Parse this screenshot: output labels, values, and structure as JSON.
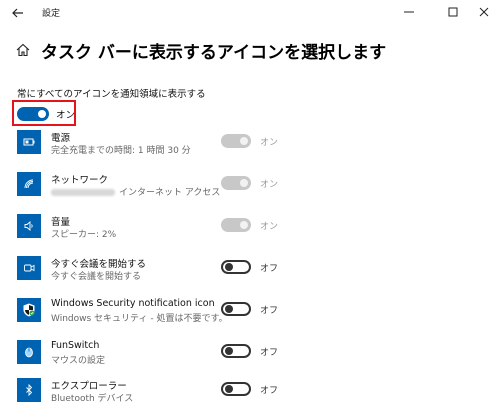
{
  "window": {
    "title": "設定"
  },
  "page": {
    "title": "タスク バーに表示するアイコンを選択します"
  },
  "always_show": {
    "label": "常にすべてのアイコンを通知領域に表示する",
    "state_label": "オン",
    "is_on": true
  },
  "items": [
    {
      "name": "電源",
      "desc": "完全充電までの時間: 1 時間 30 分",
      "state_label": "オン",
      "state": "on-disabled",
      "icon": "battery-icon"
    },
    {
      "name": "ネットワーク",
      "desc": "インターネット アクセス",
      "state_label": "オン",
      "state": "on-disabled",
      "icon": "wifi-icon"
    },
    {
      "name": "音量",
      "desc": "スピーカー: 2%",
      "state_label": "オン",
      "state": "on-disabled",
      "icon": "speaker-icon"
    },
    {
      "name": "今すぐ会議を開始する",
      "desc": "今すぐ会議を開始する",
      "state_label": "オフ",
      "state": "off",
      "icon": "meet-now-icon"
    },
    {
      "name": "Windows Security notification icon",
      "desc": "Windows セキュリティ - 処置は不要です。",
      "state_label": "オフ",
      "state": "off",
      "icon": "windows-security-shield-icon"
    },
    {
      "name": "FunSwitch",
      "desc": "マウスの設定",
      "state_label": "オフ",
      "state": "off",
      "icon": "mouse-icon"
    },
    {
      "name": "エクスプローラー",
      "desc": "Bluetooth デバイス",
      "state_label": "オフ",
      "state": "off",
      "icon": "bluetooth-icon"
    }
  ],
  "colors": {
    "accent": "#0063b1",
    "highlight": "#e3141c"
  }
}
